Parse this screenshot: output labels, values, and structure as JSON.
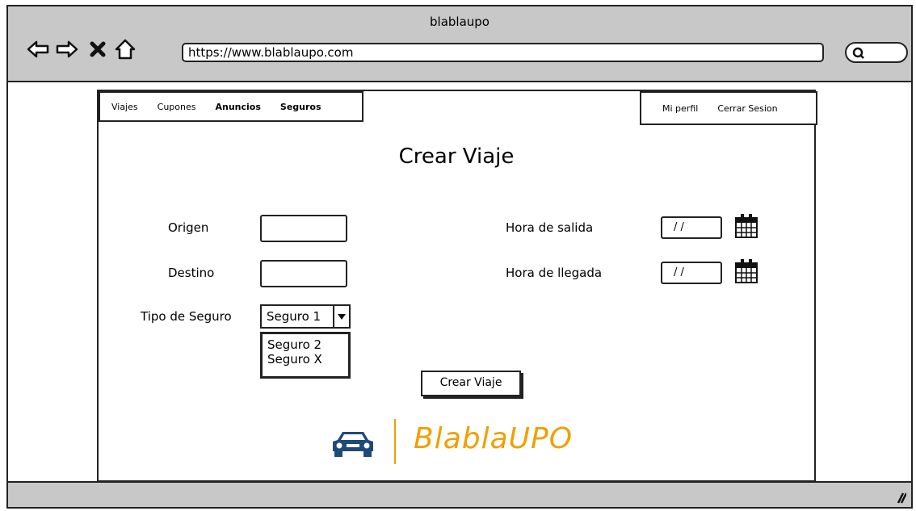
{
  "window": {
    "title": "blablaupo",
    "url": "https://www.blablaupo.com"
  },
  "navbar": {
    "left_items": [
      "Viajes",
      "Cupones",
      "Anuncios",
      "Seguros"
    ],
    "right_items": [
      "Mi perfil",
      "Cerrar Sesion"
    ]
  },
  "form": {
    "title": "Crear Viaje",
    "origen_label": "Origen",
    "destino_label": "Destino",
    "tipo_seguro_label": "Tipo de Seguro",
    "tipo_seguro_selected": "Seguro 1",
    "tipo_seguro_options": [
      "Seguro 2",
      "Seguro X"
    ],
    "hora_salida_label": "Hora de salida",
    "hora_salida_value": "/ /",
    "hora_llegada_label": "Hora de llegada",
    "hora_llegada_value": "/ /",
    "submit_label": "Crear Viaje"
  },
  "logo": {
    "text": "BlablaUPO",
    "color": "#f0a000",
    "car_color": "#1e4a78"
  },
  "icons": {
    "back": "arrow-left-icon",
    "forward": "arrow-right-icon",
    "stop": "close-icon",
    "home": "home-icon",
    "search": "search-icon",
    "calendar": "calendar-icon"
  }
}
